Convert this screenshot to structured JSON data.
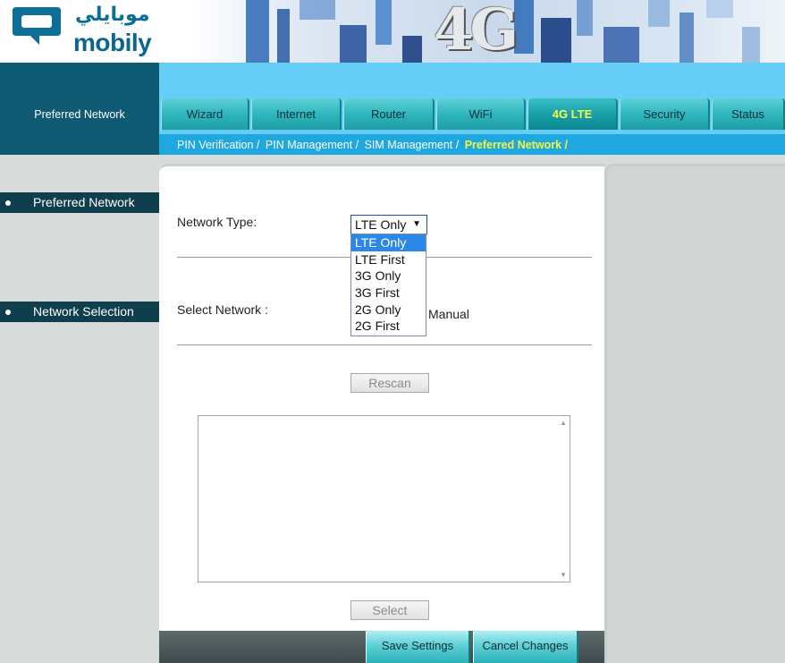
{
  "brand": {
    "name_ar": "موبايلي",
    "name_en": "mobily",
    "banner_text": "4G"
  },
  "nav": {
    "section_title": "Preferred Network",
    "tabs": [
      {
        "label": "Wizard"
      },
      {
        "label": "Internet"
      },
      {
        "label": "Router"
      },
      {
        "label": "WiFi"
      },
      {
        "label": "4G LTE",
        "active": true
      },
      {
        "label": "Security"
      },
      {
        "label": "Status"
      }
    ],
    "breadcrumb": [
      {
        "label": "PIN Verification /"
      },
      {
        "label": "PIN Management /"
      },
      {
        "label": "SIM Management /"
      },
      {
        "label": "Preferred Network /",
        "active": true
      }
    ]
  },
  "sidebar": {
    "items": [
      {
        "label": "Preferred Network",
        "active": true
      },
      {
        "label": "Network Selection"
      }
    ]
  },
  "form": {
    "network_type_label": "Network Type:",
    "network_type_value": "LTE Only",
    "network_type_options": [
      "LTE Only",
      "LTE First",
      "3G Only",
      "3G First",
      "2G Only",
      "2G First"
    ],
    "network_type_highlighted": "LTE Only",
    "select_network_label": "Select Network :",
    "select_network_mode": "Manual",
    "rescan_label": "Rescan",
    "select_label": "Select"
  },
  "actions": {
    "save_label": "Save Settings",
    "cancel_label": "Cancel Changes"
  },
  "colors": {
    "nav_dark": "#0e5a72",
    "nav_light": "#66cdf6",
    "tab": "#2fb6bd",
    "active_text": "#f8f43c",
    "sidebar_item": "#0f3f4d",
    "dropdown_highlight": "#2b88e8"
  }
}
